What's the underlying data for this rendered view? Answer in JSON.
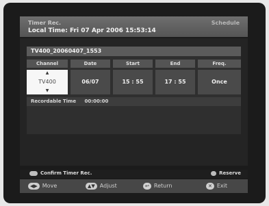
{
  "header": {
    "title": "Timer Rec.",
    "mode": "Schedule",
    "local_time": "Local Time: Fri 07 Apr 2006 15:53:14"
  },
  "program": {
    "name": "TV400_20060407_1553"
  },
  "columns": [
    "Channel",
    "Date",
    "Start",
    "End",
    "Freq."
  ],
  "values": {
    "channel": "TV400",
    "date": "06/07",
    "start": "15 : 55",
    "end": "17 : 55",
    "freq": "Once"
  },
  "remain": {
    "label": "Recordable Time",
    "value": "00:00:00"
  },
  "footer": {
    "confirm": "Confirm Timer Rec.",
    "reserve": "Reserve",
    "nav": {
      "move": "Move",
      "adjust": "Adjust",
      "return": "Return",
      "exit": "Exit"
    }
  }
}
